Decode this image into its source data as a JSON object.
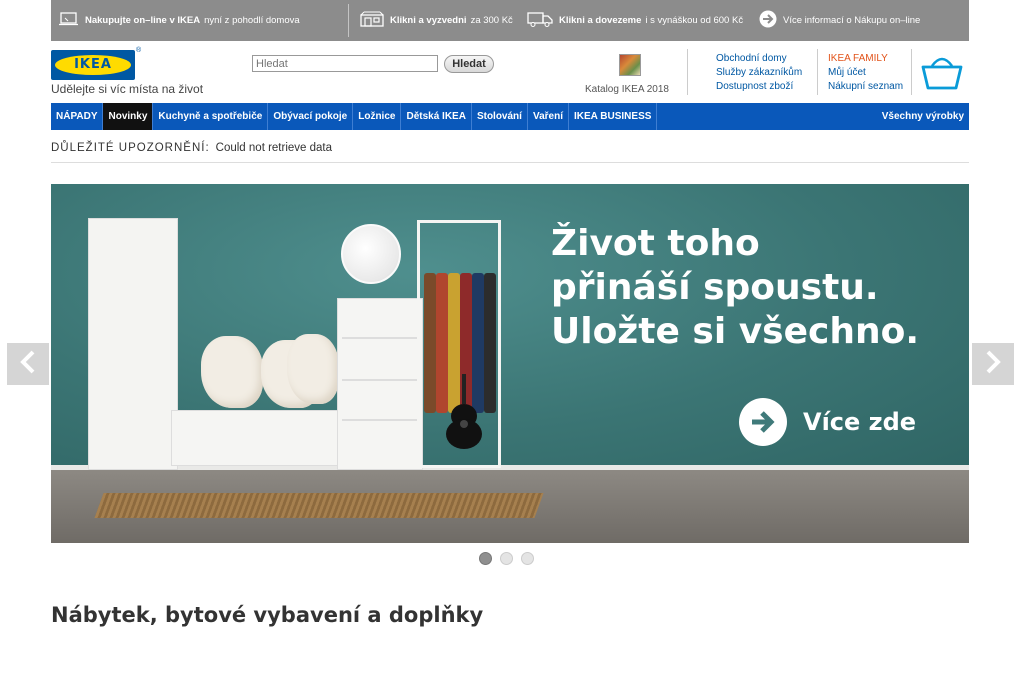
{
  "topbar": {
    "shop_online_bold": "Nakupujte on–line v IKEA",
    "shop_online_rest": "nyní z pohodlí domova",
    "click_collect_bold": "Klikni a vyzvedni",
    "click_collect_rest": "za 300 Kč",
    "click_deliver_bold": "Klikni a dovezeme",
    "click_deliver_rest": "i s vynáškou od 600 Kč",
    "more_info": "Více informací o Nákupu on–line"
  },
  "header": {
    "logo_text": "IKEA",
    "registered": "®",
    "tagline": "Udělejte si víc místa na život",
    "search_placeholder": "Hledat",
    "search_button": "Hledat",
    "catalog_label": "Katalog IKEA 2018",
    "links_col1": [
      "Obchodní domy",
      "Služby zákazníkům",
      "Dostupnost zboží"
    ],
    "links_col2": [
      "IKEA FAMILY",
      "Můj účet",
      "Nákupní seznam"
    ]
  },
  "nav": {
    "items": [
      "NÁPADY",
      "Novinky",
      "Kuchyně a spotřebiče",
      "Obývací pokoje",
      "Ložnice",
      "Dětská IKEA",
      "Stolování",
      "Vaření",
      "IKEA BUSINESS"
    ],
    "all_products": "Všechny výrobky"
  },
  "notice": {
    "label": "DŮLEŽITÉ UPOZORNĚNÍ:",
    "message": "Could not retrieve data"
  },
  "hero": {
    "headline_line1": "Život toho",
    "headline_line2": "přináší spoustu.",
    "headline_line3": "Uložte si všechno.",
    "cta_label": "Více zde"
  },
  "section": {
    "title": "Nábytek, bytové vybavení a doplňky"
  },
  "colors": {
    "nav_blue": "#0a58ba",
    "topbar_gray": "#8c8c8c",
    "hero_teal": "#3f7a7a",
    "family_red": "#e2531a"
  }
}
